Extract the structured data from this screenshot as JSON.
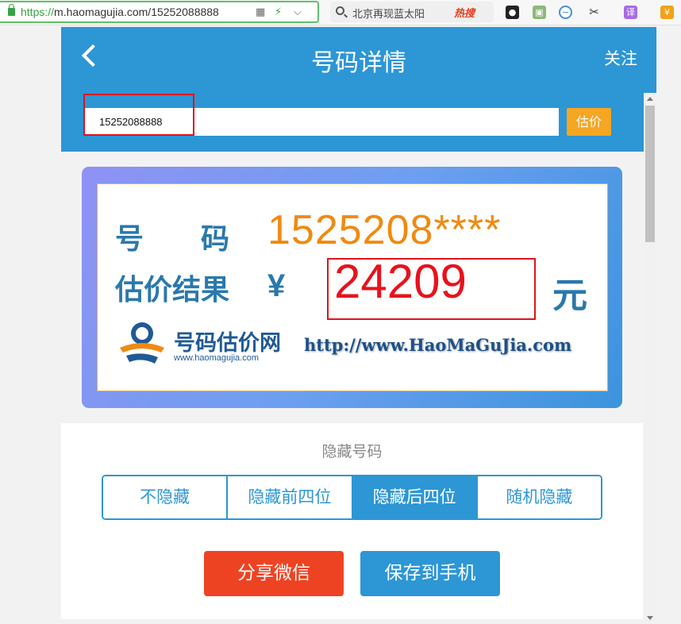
{
  "browser": {
    "url_scheme": "https://",
    "url_rest": "m.haomagujia.com/15252088888",
    "search_text": "北京再现蓝太阳",
    "hot_label": "热搜",
    "ext_translate_label": "译",
    "ext_wallet_label": "¥"
  },
  "header": {
    "title": "号码详情",
    "follow_label": "关注",
    "input_value": "15252088888",
    "estimate_label": "估价"
  },
  "result": {
    "number_label": "号　　码",
    "number_value": "1525208****",
    "price_label": "估价结果",
    "currency_symbol": "¥",
    "price_value": "24209",
    "unit": "元",
    "logo_title": "号码估价网",
    "logo_url": "www.haomagujia.com",
    "site_url": "http://www.HaoMaGuJia.com"
  },
  "options": {
    "label": "隐藏号码",
    "segments": [
      "不隐藏",
      "隐藏前四位",
      "隐藏后四位",
      "随机隐藏"
    ],
    "active_segment": "隐藏后四位",
    "share_label": "分享微信",
    "save_label": "保存到手机"
  },
  "colors": {
    "header_blue": "#2d96d5",
    "estimate_orange": "#f5a623",
    "share_red": "#ee4323",
    "price_red": "#e8121b"
  }
}
